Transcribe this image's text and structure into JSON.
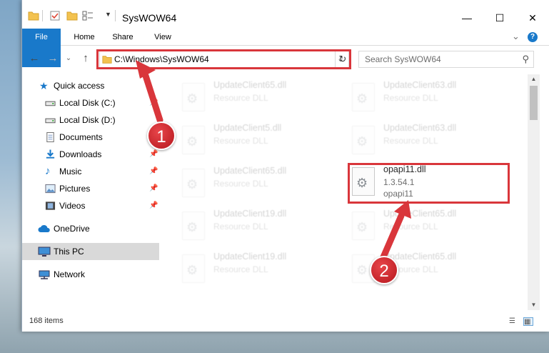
{
  "window": {
    "title": "SysWOW64",
    "minimize_glyph": "—",
    "maximize_glyph": "☐",
    "close_glyph": "✕"
  },
  "ribbon": {
    "tabs": [
      "File",
      "Home",
      "Share",
      "View"
    ],
    "expand_glyph": "⌄",
    "help_glyph": "?"
  },
  "address": {
    "path": "C:\\Windows\\SysWOW64",
    "dropdown_glyph": "⌄",
    "refresh_glyph": "↻",
    "search_placeholder": "Search SysWOW64",
    "back_glyph": "←",
    "forward_glyph": "→",
    "recent_glyph": "⌄",
    "up_glyph": "↑"
  },
  "nav": {
    "items": [
      {
        "label": "Quick access",
        "icon": "star-icon"
      },
      {
        "label": "Local Disk (C:)",
        "icon": "drive-icon"
      },
      {
        "label": "Local Disk (D:)",
        "icon": "drive-icon"
      },
      {
        "label": "Documents",
        "icon": "document-icon"
      },
      {
        "label": "Downloads",
        "icon": "download-icon"
      },
      {
        "label": "Music",
        "icon": "music-icon"
      },
      {
        "label": "Pictures",
        "icon": "pictures-icon"
      },
      {
        "label": "Videos",
        "icon": "videos-icon"
      },
      {
        "label": "OneDrive",
        "icon": "cloud-icon"
      },
      {
        "label": "This PC",
        "icon": "computer-icon"
      },
      {
        "label": "Network",
        "icon": "network-icon"
      }
    ],
    "pin_glyph": "📌"
  },
  "files": [
    {
      "name": "UpdateClient65.dll",
      "type": "Resource DLL"
    },
    {
      "name": "UpdateClient63.dll",
      "type": "Resource DLL"
    },
    {
      "name": "UpdateClient5.dll",
      "type": "Resource DLL"
    },
    {
      "name": "UpdateClient63.dll",
      "type": "Resource DLL"
    },
    {
      "name": "UpdateClient65.dll",
      "type": "Resource DLL"
    },
    {
      "name": "opapi11.dll",
      "version": "1.3.54.1",
      "description": "opapi11"
    },
    {
      "name": "UpdateClient19.dll",
      "type": "Resource DLL"
    },
    {
      "name": "UpdateClient65.dll",
      "type": "Resource DLL"
    },
    {
      "name": "UpdateClient19.dll",
      "type": "Resource DLL"
    },
    {
      "name": "UpdateClient65.dll",
      "type": "Resource DLL"
    }
  ],
  "status": {
    "item_count": "168 items"
  },
  "annotations": {
    "step1": "1",
    "step2": "2",
    "color": "#d9363b"
  },
  "colors": {
    "accent": "#1979ca",
    "selection": "#d9d9d9"
  }
}
